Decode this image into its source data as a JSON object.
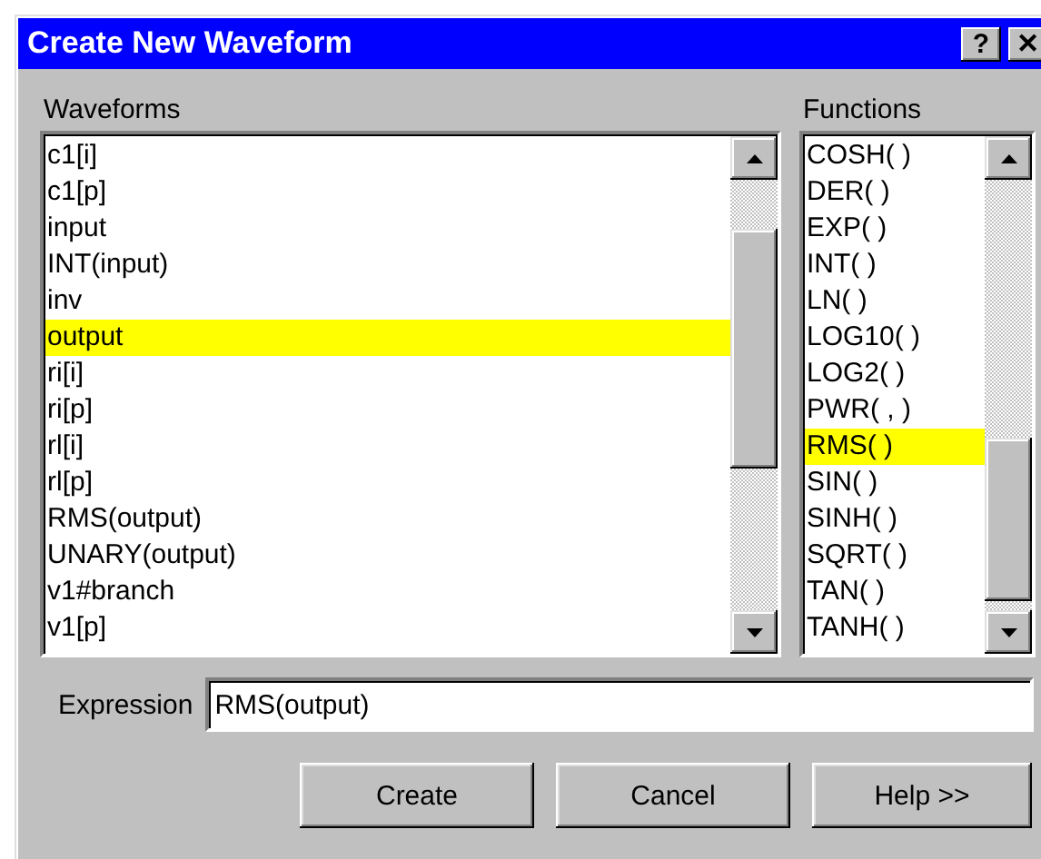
{
  "window": {
    "title": "Create New Waveform",
    "title_buttons": [
      "?",
      "✕"
    ]
  },
  "waveforms": {
    "label": "Waveforms",
    "items": [
      {
        "text": "c1[i]",
        "selected": false
      },
      {
        "text": "c1[p]",
        "selected": false
      },
      {
        "text": "input",
        "selected": false
      },
      {
        "text": "INT(input)",
        "selected": false
      },
      {
        "text": "inv",
        "selected": false
      },
      {
        "text": "output",
        "selected": true
      },
      {
        "text": "ri[i]",
        "selected": false
      },
      {
        "text": "ri[p]",
        "selected": false
      },
      {
        "text": "rl[i]",
        "selected": false
      },
      {
        "text": "rl[p]",
        "selected": false
      },
      {
        "text": "RMS(output)",
        "selected": false
      },
      {
        "text": "UNARY(output)",
        "selected": false
      },
      {
        "text": "v1#branch",
        "selected": false
      },
      {
        "text": "v1[p]",
        "selected": false
      }
    ]
  },
  "functions": {
    "label": "Functions",
    "items": [
      {
        "text": "COSH( )",
        "selected": false
      },
      {
        "text": "DER( )",
        "selected": false
      },
      {
        "text": "EXP( )",
        "selected": false
      },
      {
        "text": "INT( )",
        "selected": false
      },
      {
        "text": "LN( )",
        "selected": false
      },
      {
        "text": "LOG10( )",
        "selected": false
      },
      {
        "text": "LOG2( )",
        "selected": false
      },
      {
        "text": "PWR( , )",
        "selected": false
      },
      {
        "text": "RMS( )",
        "selected": true
      },
      {
        "text": "SIN( )",
        "selected": false
      },
      {
        "text": "SINH( )",
        "selected": false
      },
      {
        "text": "SQRT( )",
        "selected": false
      },
      {
        "text": "TAN( )",
        "selected": false
      },
      {
        "text": "TANH( )",
        "selected": false
      }
    ]
  },
  "expression": {
    "label": "Expression",
    "value": "RMS(output)"
  },
  "buttons": [
    "Create",
    "Cancel",
    "Help >>"
  ]
}
